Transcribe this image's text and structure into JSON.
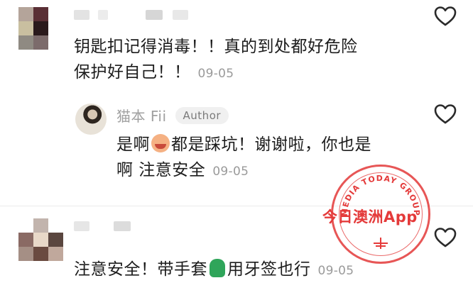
{
  "comments": [
    {
      "text_lines": [
        "钥匙扣记得消毒！！真的到处都好危险",
        "保护好自己！！"
      ],
      "date": "09-05",
      "avatar_colors": [
        "#b4a49a",
        "#5a2f35",
        "#ffffff",
        "#c9bfa0",
        "#2a1a1c",
        "#ffffff",
        "#8f8a82",
        "#7c6b6b",
        "#ffffff"
      ]
    },
    {
      "text_lines": [
        "注意安全！带手套",
        "用牙签也行"
      ],
      "date": "09-05",
      "avatar_colors": [
        "#ffffff",
        "#c2b4ad",
        "#ffffff",
        "#8a6a64",
        "#e8d8c8",
        "#5a463f",
        "#a58f85",
        "#6a4a40",
        "#c0a89c"
      ]
    }
  ],
  "reply": {
    "author": "猫本 Fii",
    "badge": "Author",
    "text_lines": [
      "是啊",
      "都是踩坑！谢谢啦，你也是",
      "啊 注意安全"
    ],
    "date": "09-05"
  },
  "watermark": {
    "arc_text": "MEDIA TODAY GROUP",
    "main_text": "今日澳洲App",
    "color": "#e43a3a"
  },
  "icons": [
    "heart-outline-icon",
    "crying-face-emoji",
    "green-glove-emoji"
  ]
}
